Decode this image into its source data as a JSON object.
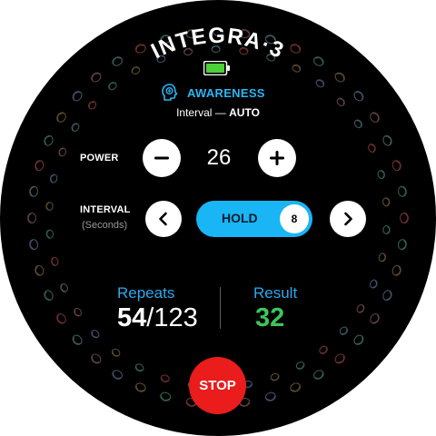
{
  "app": {
    "title": "INTEGRA·3"
  },
  "battery": {
    "level": 1.0,
    "color": "#4cd137"
  },
  "mode": {
    "icon": "head-brain-icon",
    "label": "AWARENESS",
    "color": "#2bb6f3"
  },
  "interval_info": {
    "prefix": "Interval — ",
    "value": "AUTO"
  },
  "power": {
    "label": "POWER",
    "value": "26",
    "decrease_icon": "minus-icon",
    "increase_icon": "plus-icon"
  },
  "interval": {
    "label": "INTERVAL",
    "sublabel": "(Seconds)",
    "mode": "HOLD",
    "seconds": "8",
    "prev_icon": "chevron-left-icon",
    "next_icon": "chevron-right-icon"
  },
  "repeats": {
    "label": "Repeats",
    "current": "54",
    "separator": "/",
    "total": "123"
  },
  "result": {
    "label": "Result",
    "value": "32"
  },
  "stop": {
    "label": "STOP",
    "color": "#ea1c1c"
  },
  "colors": {
    "accent": "#19b5f5",
    "result": "#3cc65a",
    "background": "#000000"
  }
}
